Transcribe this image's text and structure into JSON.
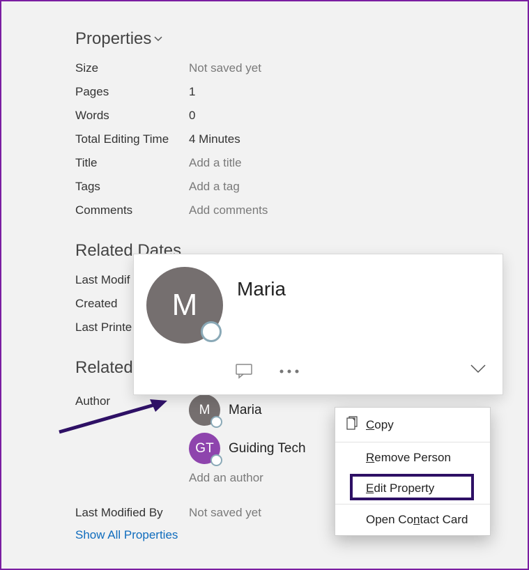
{
  "sections": {
    "properties_title": "Properties",
    "related_dates_title": "Related Dates",
    "related_people_title": "Related People"
  },
  "properties": {
    "size_label": "Size",
    "size_value": "Not saved yet",
    "pages_label": "Pages",
    "pages_value": "1",
    "words_label": "Words",
    "words_value": "0",
    "tet_label": "Total Editing Time",
    "tet_value": "4 Minutes",
    "title_label": "Title",
    "title_placeholder": "Add a title",
    "tags_label": "Tags",
    "tags_placeholder": "Add a tag",
    "comments_label": "Comments",
    "comments_placeholder": "Add comments"
  },
  "related_dates": {
    "last_modified_label": "Last Modif",
    "created_label": "Created",
    "last_printed_label": "Last Printe"
  },
  "related_people": {
    "author_label": "Author",
    "authors": [
      {
        "initials": "M",
        "name": "Maria",
        "color": "#756f6f"
      },
      {
        "initials": "GT",
        "name": "Guiding Tech",
        "color": "#8e44ad"
      }
    ],
    "add_author_label": "Add an author",
    "last_modified_by_label": "Last Modified By",
    "last_modified_by_value": "Not saved yet"
  },
  "link_show_all": "Show All Properties",
  "contact_card": {
    "initial": "M",
    "name": "Maria"
  },
  "context_menu": {
    "copy": "Copy",
    "remove_person": "Remove Person",
    "edit_property": "Edit Property",
    "open_contact_card": "Open Contact Card"
  }
}
